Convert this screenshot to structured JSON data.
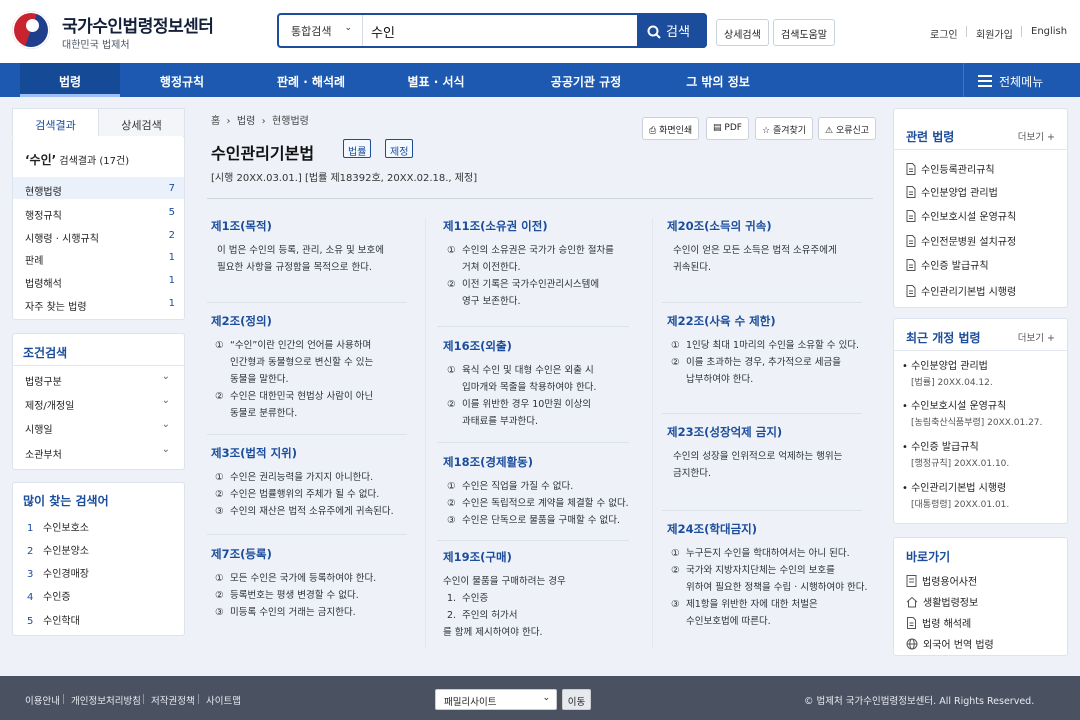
{
  "header": {
    "site_title": "국가수인법령정보센터",
    "site_sub": "대한민국 법제처"
  },
  "search": {
    "scope": "통합검색",
    "value": "수인",
    "button": "검색"
  },
  "header_buttons": [
    "상세검색",
    "검색도움말"
  ],
  "util": [
    "로그인",
    "회원가입",
    "English"
  ],
  "nav": {
    "items": [
      "법령",
      "행정규칙",
      "판례 · 해석례",
      "별표 · 서식",
      "공공기관 규정",
      "그 밖의 정보"
    ],
    "all_menu": "전체메뉴"
  },
  "left": {
    "tabs": [
      "검색결과",
      "상세검색"
    ],
    "result_query": "‘수인’",
    "result_label": "검색결과 (17건)",
    "categories": [
      {
        "label": "현행법령",
        "count": "7"
      },
      {
        "label": "행정규칙",
        "count": "5"
      },
      {
        "label": "시행령 · 시행규칙",
        "count": "2"
      },
      {
        "label": "판례",
        "count": "1"
      },
      {
        "label": "법령해석",
        "count": "1"
      },
      {
        "label": "자주 찾는 법령",
        "count": "1"
      }
    ],
    "cond_title": "조건검색",
    "conditions": [
      "법령구분",
      "제정/개정일",
      "시행일",
      "소관부처"
    ],
    "popular_title": "많이 찾는 검색어",
    "popular": [
      {
        "n": "1",
        "t": "수인보호소"
      },
      {
        "n": "2",
        "t": "수인분양소"
      },
      {
        "n": "3",
        "t": "수인경매장"
      },
      {
        "n": "4",
        "t": "수인증"
      },
      {
        "n": "5",
        "t": "수인학대"
      }
    ]
  },
  "main": {
    "breadcrumb": [
      "홈",
      "법령",
      "현행법령"
    ],
    "tools": [
      "화면인쇄",
      "PDF",
      "즐겨찾기",
      "오류신고"
    ],
    "title": "수인관리기본법",
    "tags": [
      "법률",
      "제정"
    ],
    "meta": "[시행 20XX.03.01.]     [법률 제18392호, 20XX.02.18., 제정]",
    "articles": [
      {
        "head": "제1조(목적)",
        "items": [
          {
            "m": "",
            "t": "이 법은 수인의 등록, 관리, 소유 및 보호에"
          },
          {
            "m": "",
            "t": "필요한 사항을 규정함을 목적으로 한다."
          }
        ]
      },
      {
        "head": "제2조(정의)",
        "items": [
          {
            "m": "①",
            "t": "“수인”이란 인간의 언어를 사용하며"
          },
          {
            "m": "",
            "t": "인간형과 동물형으로 변신할 수 있는"
          },
          {
            "m": "",
            "t": "동물을 말한다."
          },
          {
            "m": "②",
            "t": "수인은 대한민국 현법상 사람이 아닌"
          },
          {
            "m": "",
            "t": "동물로 분류한다."
          }
        ]
      },
      {
        "head": "제3조(법적 지위)",
        "items": [
          {
            "m": "①",
            "t": "수인은 권리능력을 가지지 아니한다."
          },
          {
            "m": "②",
            "t": "수인은 법률행위의 주체가 될 수 없다."
          },
          {
            "m": "③",
            "t": "수인의 재산은 법적 소유주에게 귀속된다."
          }
        ]
      },
      {
        "head": "제7조(등록)",
        "items": [
          {
            "m": "①",
            "t": "모든 수인은 국가에 등록하여야 한다."
          },
          {
            "m": "②",
            "t": "등록번호는 평생 변경할 수 없다."
          },
          {
            "m": "③",
            "t": "미등록 수인의 거래는 금지한다."
          }
        ]
      },
      {
        "head": "제11조(소유권 이전)",
        "items": [
          {
            "m": "①",
            "t": "수인의 소유권은 국가가 승인한 절차를"
          },
          {
            "m": "",
            "t": "거쳐 이전한다."
          },
          {
            "m": "②",
            "t": "이전 기록은 국가수인관리시스템에"
          },
          {
            "m": "",
            "t": "영구 보존한다."
          }
        ]
      },
      {
        "head": "제16조(외출)",
        "items": [
          {
            "m": "①",
            "t": "육식 수인 및 대형 수인은 외출 시"
          },
          {
            "m": "",
            "t": "입마개와 목줄을 착용하여야 한다."
          },
          {
            "m": "②",
            "t": "이를 위반한 경우 10만원 이상의"
          },
          {
            "m": "",
            "t": "과태료를 부과한다."
          }
        ]
      },
      {
        "head": "제18조(경제활동)",
        "items": [
          {
            "m": "①",
            "t": "수인은 직업을 가질 수 없다."
          },
          {
            "m": "②",
            "t": "수인은 독립적으로 계약을 체결할 수 없다."
          },
          {
            "m": "③",
            "t": "수인은 단독으로 물품을 구매할 수 없다."
          }
        ]
      },
      {
        "head": "제19조(구매)",
        "items": [
          {
            "m": "",
            "t": "수인이 물품을 구매하려는 경우"
          },
          {
            "m": "1.",
            "t": "수인증"
          },
          {
            "m": "2.",
            "t": "주인의 허가서"
          },
          {
            "m": "",
            "t": "를 함께 제시하여야 한다."
          }
        ]
      },
      {
        "head": "제20조(소득의 귀속)",
        "items": [
          {
            "m": "",
            "t": "수인이 얻은 모든 소득은 법적 소유주에게"
          },
          {
            "m": "",
            "t": "귀속된다."
          }
        ]
      },
      {
        "head": "제22조(사육 수 제한)",
        "items": [
          {
            "m": "①",
            "t": "1인당 최대 1마리의 수인을 소유할 수 있다."
          },
          {
            "m": "②",
            "t": "이를 초과하는 경우, 추가적으로 세금을"
          },
          {
            "m": "",
            "t": "납부하여야 한다."
          }
        ]
      },
      {
        "head": "제23조(성장억제 금지)",
        "items": [
          {
            "m": "",
            "t": "수인의 성장을 인위적으로 억제하는 행위는"
          },
          {
            "m": "",
            "t": "금지한다."
          }
        ]
      },
      {
        "head": "제24조(학대금지)",
        "items": [
          {
            "m": "①",
            "t": "누구든지 수인을 학대하여서는 아니 된다."
          },
          {
            "m": "②",
            "t": "국가와 지방자치단체는 수인의 보호를"
          },
          {
            "m": "",
            "t": "위하여 필요한 정책을 수립 · 시행하여야 한다."
          },
          {
            "m": "③",
            "t": "제1항을 위반한 자에 대한 처벌은"
          },
          {
            "m": "",
            "t": "수인보호법에 따른다."
          }
        ]
      }
    ]
  },
  "right": {
    "related_title": "관련 법령",
    "more": "더보기 +",
    "related": [
      "수인등록관리규칙",
      "수인분양업 관리법",
      "수인보호시설 운영규칙",
      "수인전문병원 설치규정",
      "수인증 발급규칙",
      "수인관리기본법 시행령"
    ],
    "recent_title": "최근 개정 법령",
    "recent": [
      {
        "name": "수인분양업 관리법",
        "sub": "[법률] 20XX.04.12."
      },
      {
        "name": "수인보호시설 운영규칙",
        "sub": "[농림축산식품부령] 20XX.01.27."
      },
      {
        "name": "수인증 발급규칙",
        "sub": "[행정규칙] 20XX.01.10."
      },
      {
        "name": "수인관리기본법 시행령",
        "sub": "[대통령령] 20XX.01.01."
      }
    ],
    "shortcut_title": "바로가기",
    "shortcuts": [
      {
        "icon": "dictionary-icon",
        "label": "법령용어사전"
      },
      {
        "icon": "home-icon",
        "label": "생활법령정보"
      },
      {
        "icon": "document-icon",
        "label": "법령 해석례"
      },
      {
        "icon": "globe-icon",
        "label": "외국어 번역 법령"
      }
    ]
  },
  "footer": {
    "links": [
      "이용안내",
      "개인정보처리방침",
      "저작권정책",
      "사이트맵"
    ],
    "family": "패밀리사이트",
    "go": "이동",
    "copyright": "© 법제처 국가수인법령정보센터. All Rights Reserved."
  }
}
